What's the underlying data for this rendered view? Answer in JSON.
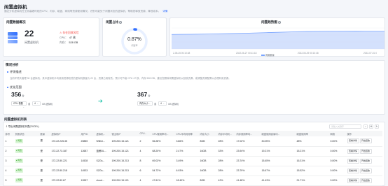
{
  "page": {
    "title": "闲置虚拟机",
    "description": "通过分析虚拟机在业务高峰时段的CPU、内存、磁盘、网络等资源使用情况，识别可能处于闲置状态的虚拟机，帮助您释放资源、降低成本。",
    "more_link": "详情"
  },
  "summary": {
    "title": "闲置数据概况",
    "count": "22",
    "count_label": "闲置虚拟机",
    "risk_label": "存在回收风险",
    "cpu_label": "CPU：",
    "cpu_value": "47 核",
    "mem_label": "内存：",
    "mem_value": "528 GB"
  },
  "ratio": {
    "title": "闲置占比",
    "value": "0.87%",
    "sub": "闲置率",
    "fraction": 0.0087
  },
  "trend": {
    "title": "闲置趋势图",
    "legend": "闲置数量",
    "x_labels": [
      "2-06-25 00:10:48",
      "2022-06-27 00:11:18",
      "2022-06-29 00:10:48",
      "2022-07-01 0"
    ],
    "y_values": [
      18,
      18.2,
      18.5,
      19,
      19.6,
      20.3,
      21,
      21.6,
      22,
      22.1,
      22,
      22
    ]
  },
  "analysis": {
    "title": "情况分析",
    "eval_title": "评测描述",
    "eval_text": "当前环境共管理 30 台虚拟机，其中虚拟机平均使用资源较低的虚拟机数量为 22 台，资源占用较低。预计可节省 CPU 47 核，内存 528 GB，建议您删除闲置虚拟机以回收资源，或调整资源配置以合理利用资源。",
    "opt_title": "优化范围",
    "left_num": "356",
    "left_unit": "台",
    "left_cond": "CPU 核数",
    "left_op": "或",
    "left_val": "4",
    "left_suffix": "GB 虚拟机",
    "right_num": "367",
    "right_unit": "台",
    "right_cond": "内存大小",
    "right_op": "或",
    "right_val": "4",
    "right_suffix": "GB 虚拟机"
  },
  "table": {
    "title": "闲置虚拟机列表",
    "export_label": "导出闲置虚拟机列表(EXCEL)",
    "search_placeholder": "请输入关键字",
    "columns": [
      "序号",
      "负载状态",
      "数量",
      "虚拟机IP",
      "用户ID",
      "虚拟机...",
      "宿主机IP",
      "CPU...",
      "CPU使用率均...",
      "CPU平均利用率",
      "内存大小",
      "内存平均利...",
      "内存使用率均...",
      "磁盘使用容量均...",
      "磁盘使用率",
      "网络",
      "操作"
    ],
    "status_label": "闲置",
    "detail_label": "查看详情",
    "delete_label": "开启回收",
    "rows": [
      {
        "no": "1",
        "qty": "是",
        "ip": "172.22.225.35",
        "uid": "20889",
        "name": "WNhe...",
        "host": "199.200.15.121",
        "cpu": "2",
        "cpu_max": "56.28%",
        "cpu_avg": "3.86%",
        "mem": "8GB",
        "mem_avg": "28%",
        "mem_max": "17.02%",
        "disk_avg": "30.05%",
        "disk": "48%",
        "net": "0.00%"
      },
      {
        "no": "2",
        "qty": "是",
        "ip": "172.22.73.187",
        "uid": "12687",
        "name": "蓝鲸DL...",
        "host": "199.200.15.121",
        "cpu": "4",
        "cpu_max": "68.20%",
        "cpu_avg": "2.47%",
        "mem": "16GB",
        "mem_avg": "33%",
        "mem_max": "23.94%",
        "disk_avg": "19.21%",
        "disk": "15.21%",
        "net": "0.00%"
      },
      {
        "no": "3",
        "qty": "是",
        "ip": "172.22.80.221",
        "uid": "14528",
        "name": "SZGs...",
        "host": "199.200.15.213",
        "cpu": "8",
        "cpu_max": "69.02%",
        "cpu_avg": "3.49%",
        "mem": "16GB",
        "mem_avg": "28%",
        "mem_max": "23.74%",
        "disk_avg": "15.45%",
        "disk": "16.31%",
        "net": "0.00%"
      },
      {
        "no": "4",
        "qty": "是",
        "ip": "172.22.80.218",
        "uid": "14533",
        "name": "SZGs...",
        "host": "199.200.15.213",
        "cpu": "6",
        "cpu_max": "54.72%",
        "cpu_avg": "6.93%",
        "mem": "16GB",
        "mem_avg": "28%",
        "mem_max": "23.79%",
        "disk_avg": "15.67%",
        "disk": "15.52%",
        "net": "0.00%"
      },
      {
        "no": "5",
        "qty": "是",
        "ip": "172.22.82.67",
        "uid": "19957",
        "name": "cloud...",
        "host": "199.200.15.121",
        "cpu": "4",
        "cpu_max": "47.61%",
        "cpu_avg": "18.40%",
        "mem": "8GB",
        "mem_avg": "42%",
        "mem_max": "41.48%",
        "disk_avg": "41.43%",
        "disk": "21.71%",
        "net": "0.00%"
      }
    ]
  },
  "colors": {
    "accent": "#3370ff",
    "risk": "#f54a45",
    "idle_tag": "#2ea121",
    "area": "#7aa5ff"
  }
}
